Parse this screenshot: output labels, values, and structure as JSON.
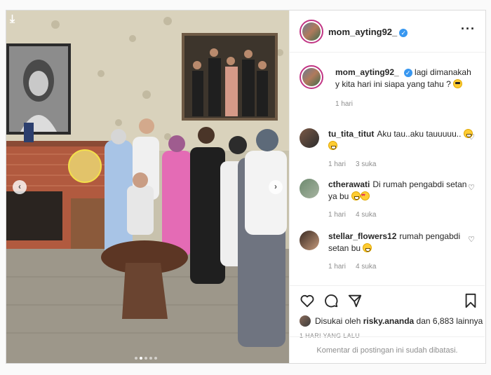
{
  "post": {
    "username": "mom_ayting92_",
    "caption": "lagi dimanakah y kita hari ini siapa yang tahu ?",
    "caption_time": "1 hari",
    "likes_prefix": "Disukai oleh",
    "liked_by": "risky.ananda",
    "likes_suffix": "dan 6,883 lainnya",
    "timestamp": "1 HARI YANG LALU",
    "comments_closed": "Komentar di postingan ini sudah dibatasi.",
    "carousel_count": 5,
    "carousel_active": 2
  },
  "comments": [
    {
      "user": "tu_tita_titut",
      "text": "Aku tau..aku tauuuuu..",
      "time": "1 hari",
      "likes": "3 suka",
      "emoji": "grin-grin"
    },
    {
      "user": "ctherawati",
      "text": "Di rumah pengabdi setan ya bu",
      "time": "1 hari",
      "likes": "4 suka",
      "emoji": "grin-love"
    },
    {
      "user": "stellar_flowers12",
      "text": "rumah pengabdi setan bu",
      "time": "1 hari",
      "likes": "4 suka",
      "emoji": "grin"
    }
  ],
  "icons": {
    "more": "more-options-icon",
    "like": "heart-icon",
    "comment": "comment-icon",
    "share": "send-icon",
    "save": "bookmark-icon",
    "download": "download-arrow-icon",
    "prev": "chevron-left-icon",
    "next": "chevron-right-icon"
  },
  "colors": {
    "verified": "#3897f0",
    "story_ring": "#c13584",
    "muted_text": "#8e8e8e",
    "border": "#dbdbdb"
  }
}
